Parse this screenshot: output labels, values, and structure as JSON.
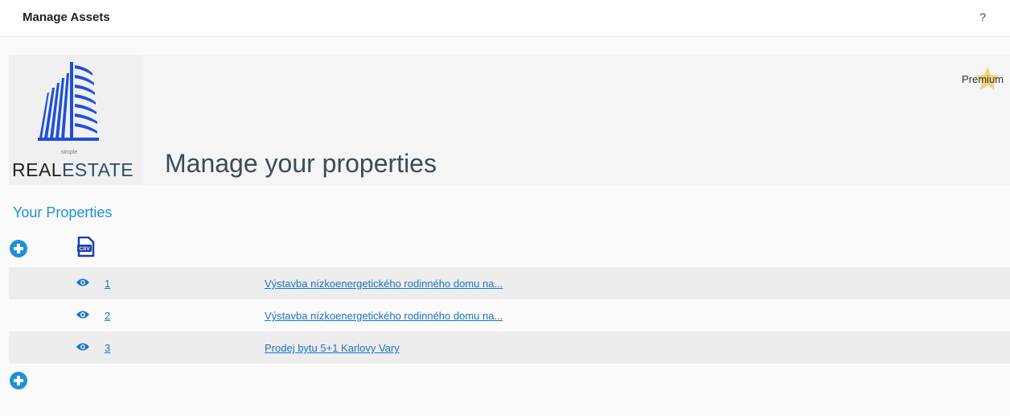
{
  "header": {
    "title": "Manage Assets",
    "help": "?"
  },
  "logo": {
    "small_text": "simple",
    "word_part1": "REAL",
    "word_part2": "ESTATE",
    "icon": "building-icon",
    "brand_blue": "#1f4fd8"
  },
  "page": {
    "heading": "Manage your properties",
    "premium_label": "Premium",
    "premium_icon": "star-icon"
  },
  "properties": {
    "section_title": "Your Properties",
    "add_icon": "plus-circle-icon",
    "csv_icon": "csv-file-icon",
    "view_icon": "eye-icon",
    "rows": [
      {
        "id": "1",
        "title": "Výstavba nízkoenergetického rodinného domu na..."
      },
      {
        "id": "2",
        "title": "Výstavba nízkoenergetického rodinného domu na..."
      },
      {
        "id": "3",
        "title": "Prodej bytu 5+1 Karlovy Vary"
      }
    ]
  },
  "colors": {
    "accent": "#1e90d8",
    "link": "#1a73c8"
  }
}
